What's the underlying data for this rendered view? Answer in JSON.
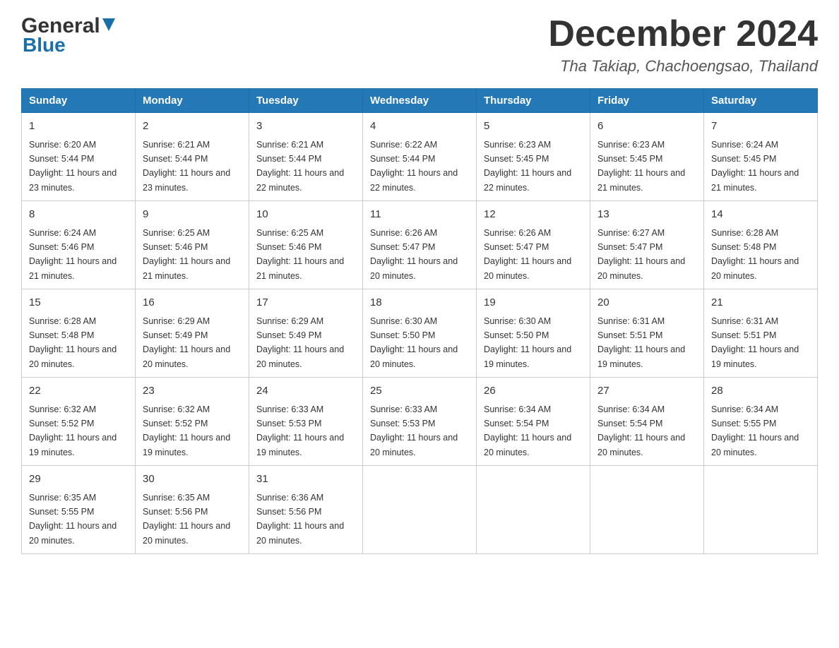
{
  "header": {
    "month_title": "December 2024",
    "location": "Tha Takiap, Chachoengsao, Thailand",
    "logo_general": "General",
    "logo_blue": "Blue"
  },
  "weekdays": [
    "Sunday",
    "Monday",
    "Tuesday",
    "Wednesday",
    "Thursday",
    "Friday",
    "Saturday"
  ],
  "weeks": [
    [
      {
        "day": "1",
        "sunrise": "6:20 AM",
        "sunset": "5:44 PM",
        "daylight": "11 hours and 23 minutes."
      },
      {
        "day": "2",
        "sunrise": "6:21 AM",
        "sunset": "5:44 PM",
        "daylight": "11 hours and 23 minutes."
      },
      {
        "day": "3",
        "sunrise": "6:21 AM",
        "sunset": "5:44 PM",
        "daylight": "11 hours and 22 minutes."
      },
      {
        "day": "4",
        "sunrise": "6:22 AM",
        "sunset": "5:44 PM",
        "daylight": "11 hours and 22 minutes."
      },
      {
        "day": "5",
        "sunrise": "6:23 AM",
        "sunset": "5:45 PM",
        "daylight": "11 hours and 22 minutes."
      },
      {
        "day": "6",
        "sunrise": "6:23 AM",
        "sunset": "5:45 PM",
        "daylight": "11 hours and 21 minutes."
      },
      {
        "day": "7",
        "sunrise": "6:24 AM",
        "sunset": "5:45 PM",
        "daylight": "11 hours and 21 minutes."
      }
    ],
    [
      {
        "day": "8",
        "sunrise": "6:24 AM",
        "sunset": "5:46 PM",
        "daylight": "11 hours and 21 minutes."
      },
      {
        "day": "9",
        "sunrise": "6:25 AM",
        "sunset": "5:46 PM",
        "daylight": "11 hours and 21 minutes."
      },
      {
        "day": "10",
        "sunrise": "6:25 AM",
        "sunset": "5:46 PM",
        "daylight": "11 hours and 21 minutes."
      },
      {
        "day": "11",
        "sunrise": "6:26 AM",
        "sunset": "5:47 PM",
        "daylight": "11 hours and 20 minutes."
      },
      {
        "day": "12",
        "sunrise": "6:26 AM",
        "sunset": "5:47 PM",
        "daylight": "11 hours and 20 minutes."
      },
      {
        "day": "13",
        "sunrise": "6:27 AM",
        "sunset": "5:47 PM",
        "daylight": "11 hours and 20 minutes."
      },
      {
        "day": "14",
        "sunrise": "6:28 AM",
        "sunset": "5:48 PM",
        "daylight": "11 hours and 20 minutes."
      }
    ],
    [
      {
        "day": "15",
        "sunrise": "6:28 AM",
        "sunset": "5:48 PM",
        "daylight": "11 hours and 20 minutes."
      },
      {
        "day": "16",
        "sunrise": "6:29 AM",
        "sunset": "5:49 PM",
        "daylight": "11 hours and 20 minutes."
      },
      {
        "day": "17",
        "sunrise": "6:29 AM",
        "sunset": "5:49 PM",
        "daylight": "11 hours and 20 minutes."
      },
      {
        "day": "18",
        "sunrise": "6:30 AM",
        "sunset": "5:50 PM",
        "daylight": "11 hours and 20 minutes."
      },
      {
        "day": "19",
        "sunrise": "6:30 AM",
        "sunset": "5:50 PM",
        "daylight": "11 hours and 19 minutes."
      },
      {
        "day": "20",
        "sunrise": "6:31 AM",
        "sunset": "5:51 PM",
        "daylight": "11 hours and 19 minutes."
      },
      {
        "day": "21",
        "sunrise": "6:31 AM",
        "sunset": "5:51 PM",
        "daylight": "11 hours and 19 minutes."
      }
    ],
    [
      {
        "day": "22",
        "sunrise": "6:32 AM",
        "sunset": "5:52 PM",
        "daylight": "11 hours and 19 minutes."
      },
      {
        "day": "23",
        "sunrise": "6:32 AM",
        "sunset": "5:52 PM",
        "daylight": "11 hours and 19 minutes."
      },
      {
        "day": "24",
        "sunrise": "6:33 AM",
        "sunset": "5:53 PM",
        "daylight": "11 hours and 19 minutes."
      },
      {
        "day": "25",
        "sunrise": "6:33 AM",
        "sunset": "5:53 PM",
        "daylight": "11 hours and 20 minutes."
      },
      {
        "day": "26",
        "sunrise": "6:34 AM",
        "sunset": "5:54 PM",
        "daylight": "11 hours and 20 minutes."
      },
      {
        "day": "27",
        "sunrise": "6:34 AM",
        "sunset": "5:54 PM",
        "daylight": "11 hours and 20 minutes."
      },
      {
        "day": "28",
        "sunrise": "6:34 AM",
        "sunset": "5:55 PM",
        "daylight": "11 hours and 20 minutes."
      }
    ],
    [
      {
        "day": "29",
        "sunrise": "6:35 AM",
        "sunset": "5:55 PM",
        "daylight": "11 hours and 20 minutes."
      },
      {
        "day": "30",
        "sunrise": "6:35 AM",
        "sunset": "5:56 PM",
        "daylight": "11 hours and 20 minutes."
      },
      {
        "day": "31",
        "sunrise": "6:36 AM",
        "sunset": "5:56 PM",
        "daylight": "11 hours and 20 minutes."
      },
      null,
      null,
      null,
      null
    ]
  ],
  "labels": {
    "sunrise_prefix": "Sunrise: ",
    "sunset_prefix": "Sunset: ",
    "daylight_prefix": "Daylight: "
  }
}
